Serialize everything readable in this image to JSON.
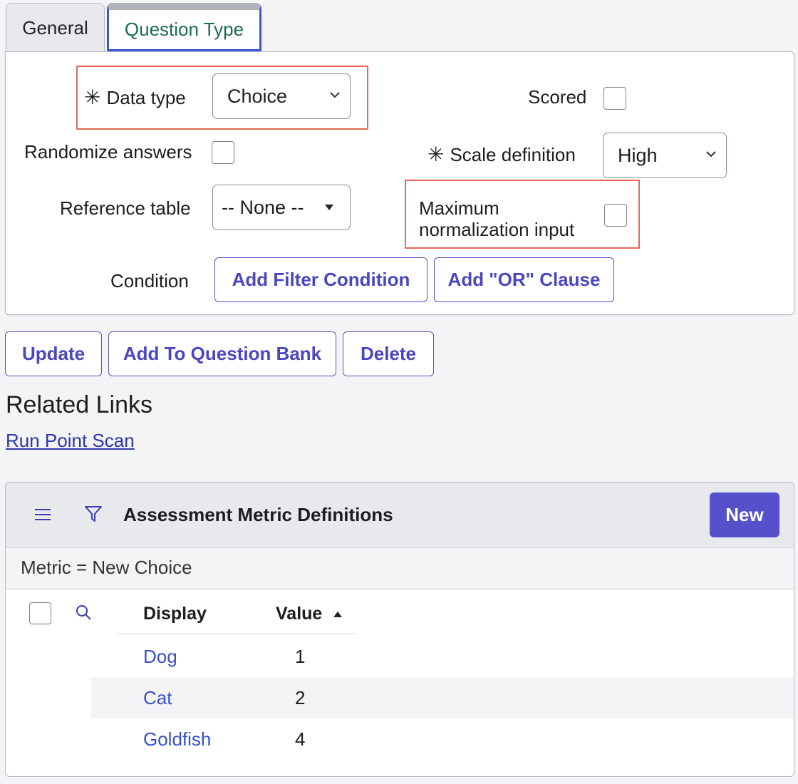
{
  "tabs": [
    {
      "label": "General"
    },
    {
      "label": "Question Type"
    }
  ],
  "form": {
    "data_type": {
      "label": "Data type",
      "value": "Choice"
    },
    "scored": {
      "label": "Scored"
    },
    "randomize": {
      "label": "Randomize answers"
    },
    "scale_definition": {
      "label": "Scale definition",
      "value": "High"
    },
    "reference_table": {
      "label": "Reference table",
      "value": "-- None --"
    },
    "max_norm": {
      "label_line1": "Maximum",
      "label_line2": "normalization input"
    },
    "condition": {
      "label": "Condition",
      "add_filter": "Add Filter Condition",
      "add_or": "Add \"OR\" Clause"
    }
  },
  "actions": {
    "update": "Update",
    "add_bank": "Add To Question Bank",
    "delete": "Delete"
  },
  "related": {
    "heading": "Related Links",
    "link": "Run Point Scan"
  },
  "list": {
    "title": "Assessment Metric Definitions",
    "new_label": "New",
    "filter": "Metric = New Choice",
    "columns": {
      "display": "Display",
      "value": "Value"
    },
    "rows": [
      {
        "display": "Dog",
        "value": "1"
      },
      {
        "display": "Cat",
        "value": "2"
      },
      {
        "display": "Goldfish",
        "value": "4"
      }
    ]
  },
  "colors": {
    "accent": "#5551cc",
    "highlight": "#e5675a",
    "active_tab_text": "#1c6b4d"
  }
}
